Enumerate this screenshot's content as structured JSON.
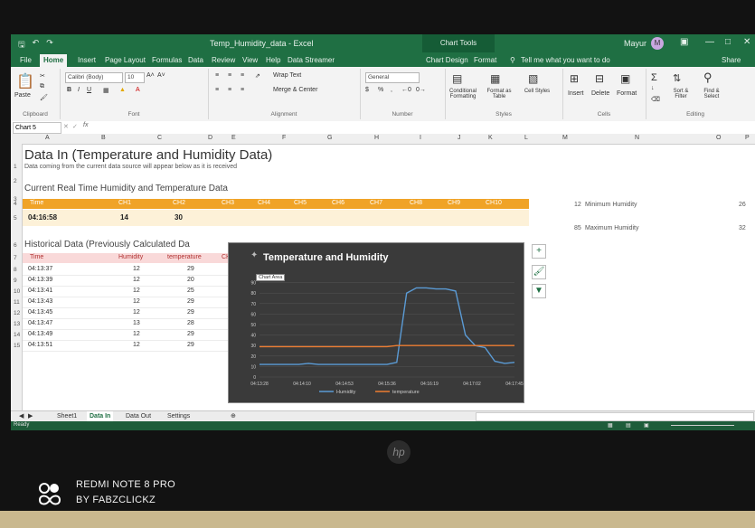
{
  "window": {
    "title": "Temp_Humidity_data - Excel",
    "chart_tools": "Chart Tools",
    "user": "Mayur",
    "user_initial": "M"
  },
  "ribbon_tabs": [
    "File",
    "Home",
    "Insert",
    "Page Layout",
    "Formulas",
    "Data",
    "Review",
    "View",
    "Help",
    "Data Streamer",
    "Chart Design",
    "Format"
  ],
  "tell_me": "Tell me what you want to do",
  "share": "Share",
  "ribbon": {
    "font_name": "Calibri (Body)",
    "font_size": "10",
    "clipboard_label": "Clipboard",
    "font_label": "Font",
    "alignment_label": "Alignment",
    "number_label": "Number",
    "styles_label": "Styles",
    "cells_label": "Cells",
    "editing_label": "Editing",
    "paste": "Paste",
    "wrap_text": "Wrap Text",
    "merge_center": "Merge & Center",
    "number_format": "General",
    "conditional": "Conditional Formatting",
    "format_table": "Format as Table",
    "cell_styles": "Cell Styles",
    "insert": "Insert",
    "delete": "Delete",
    "format": "Format",
    "sort_filter": "Sort & Filter",
    "find_select": "Find & Select"
  },
  "formula_bar": {
    "name_box": "Chart 5",
    "fx": "fx"
  },
  "columns": [
    "A",
    "B",
    "C",
    "D",
    "E",
    "F",
    "G",
    "H",
    "I",
    "J",
    "K",
    "L",
    "M",
    "N",
    "O",
    "P"
  ],
  "sheet": {
    "title": "Data In (Temperature and Humidity Data)",
    "subtitle": "Data coming from the current data source will appear below as it is received",
    "realtime_heading": "Current Real Time Humidity and Temperature Data",
    "realtime_headers": [
      "Time",
      "CH1",
      "CH2",
      "CH3",
      "CH4",
      "CH5",
      "CH6",
      "CH7",
      "CH8",
      "CH9",
      "CH10"
    ],
    "realtime_values": [
      "04:16:58",
      "14",
      "30"
    ],
    "historical_heading": "Historical Data (Previously Calculated Da",
    "historical_headers": [
      "Time",
      "Humidity",
      "temperature",
      "CH"
    ],
    "historical_rows": [
      [
        "04:13:37",
        "12",
        "29"
      ],
      [
        "04:13:39",
        "12",
        "20"
      ],
      [
        "04:13:41",
        "12",
        "25"
      ],
      [
        "04:13:43",
        "12",
        "29"
      ],
      [
        "04:13:45",
        "12",
        "29"
      ],
      [
        "04:13:47",
        "13",
        "28"
      ],
      [
        "04:13:49",
        "12",
        "29"
      ],
      [
        "04:13:51",
        "12",
        "29"
      ]
    ],
    "stats": [
      {
        "value": "12",
        "label": "Minimum Humidity"
      },
      {
        "value": "85",
        "label": "Maximum Humidity"
      }
    ],
    "stats_right": [
      "26",
      "32"
    ]
  },
  "chart_tooltip": "Chart Area",
  "chart_data": {
    "type": "line",
    "title": "Temperature and Humidity",
    "x": [
      "04:13:28",
      "04:14:10",
      "04:14:53",
      "04:15:36",
      "04:16:19",
      "04:17:02",
      "04:17:45"
    ],
    "ylim": [
      0,
      100
    ],
    "yticks": [
      0,
      10,
      20,
      30,
      40,
      50,
      60,
      70,
      80,
      90
    ],
    "series": [
      {
        "name": "Humidity",
        "color": "#5b9bd5",
        "values": [
          12,
          12,
          12,
          12,
          12,
          13,
          12,
          12,
          12,
          12,
          12,
          12,
          12,
          12,
          14,
          80,
          85,
          85,
          84,
          84,
          82,
          40,
          30,
          28,
          15,
          13,
          14
        ]
      },
      {
        "name": "temperature",
        "color": "#ed7d31",
        "values": [
          29,
          29,
          29,
          29,
          29,
          29,
          29,
          29,
          29,
          29,
          29,
          29,
          29,
          29,
          30,
          30,
          30,
          30,
          30,
          30,
          30,
          30,
          30,
          30,
          30,
          30,
          30
        ]
      }
    ],
    "legend": "bottom",
    "grid": true
  },
  "sheet_tabs": [
    "Sheet1",
    "Data In",
    "Data Out",
    "Settings"
  ],
  "status": "Ready",
  "watermark": {
    "line1": "REDMI NOTE 8 PRO",
    "line2": "BY FABZCLICKZ"
  },
  "laptop_logo": "hp"
}
